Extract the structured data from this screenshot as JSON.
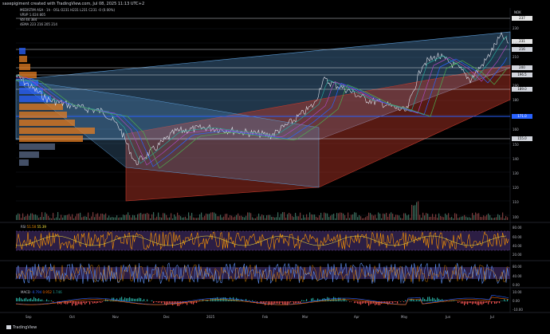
{
  "header": {
    "text": "saxepigiment created with TradingView.com, Jul 08, 2025 11:13 UTC+2"
  },
  "legend": {
    "line1": "MEDISTIM ASA · 1h · OSL",
    "line1_vals": "O231 H231 L231 C231 -0 (0.00%)",
    "line2": "VRVP  1.024  805",
    "line3": "Vol  44  384",
    "line4": "4EMA  223  216  205  214"
  },
  "currency": "NOK",
  "price_labels": [
    {
      "text": "237",
      "y": 23,
      "style": "w"
    },
    {
      "text": "231",
      "y": 52,
      "style": "w"
    },
    {
      "text": "216",
      "y": 62,
      "style": ""
    },
    {
      "text": "200",
      "y": 85,
      "style": ""
    },
    {
      "text": "196.5",
      "y": 94,
      "style": ""
    },
    {
      "text": "189.0",
      "y": 112,
      "style": ""
    },
    {
      "text": "171.0",
      "y": 146,
      "style": "b"
    },
    {
      "text": "155.0",
      "y": 174,
      "style": ""
    }
  ],
  "price_ticks": [
    {
      "text": "230",
      "y": 36
    },
    {
      "text": "220",
      "y": 54
    },
    {
      "text": "210",
      "y": 72
    },
    {
      "text": "190",
      "y": 108
    },
    {
      "text": "180",
      "y": 126
    },
    {
      "text": "160",
      "y": 163
    },
    {
      "text": "150",
      "y": 182
    },
    {
      "text": "140",
      "y": 200
    },
    {
      "text": "130",
      "y": 218
    },
    {
      "text": "120",
      "y": 236
    },
    {
      "text": "110",
      "y": 254
    },
    {
      "text": "100",
      "y": 273
    }
  ],
  "rsi": {
    "label": "RSI",
    "v1": "51.50",
    "v2": "55.39",
    "ticks": [
      {
        "text": "80.00",
        "y": 286
      },
      {
        "text": "60.00",
        "y": 298
      },
      {
        "text": "40.00",
        "y": 309
      },
      {
        "text": "20.00",
        "y": 320
      }
    ]
  },
  "stoch": {
    "ticks": [
      {
        "text": "80.00",
        "y": 335
      },
      {
        "text": "40.00",
        "y": 347
      },
      {
        "text": "0.00",
        "y": 358
      }
    ]
  },
  "macd": {
    "label": "MACD",
    "v1": "-0.794",
    "v2": "0.952",
    "v3": "1.746",
    "ticks": [
      {
        "text": "10.00",
        "y": 367
      },
      {
        "text": "0.00",
        "y": 378
      },
      {
        "text": "-10.00",
        "y": 389
      }
    ]
  },
  "x_ticks": [
    {
      "text": "Sep",
      "x": 37
    },
    {
      "text": "Oct",
      "x": 92
    },
    {
      "text": "Nov",
      "x": 146
    },
    {
      "text": "Dec",
      "x": 210
    },
    {
      "text": "2025",
      "x": 264
    },
    {
      "text": "Feb",
      "x": 334
    },
    {
      "text": "Mar",
      "x": 384
    },
    {
      "text": "Apr",
      "x": 449
    },
    {
      "text": "May",
      "x": 508
    },
    {
      "text": "Jun",
      "x": 564
    },
    {
      "text": "Jul",
      "x": 620
    }
  ],
  "brand": "TradingView",
  "colors": {
    "up": "#d1d4dc",
    "fib_blue": "#2962ff",
    "channel_blue": "#5b9bd5",
    "channel_red": "#c0392b",
    "rsi": "#ff9800",
    "stoch": "#5b8def"
  }
}
